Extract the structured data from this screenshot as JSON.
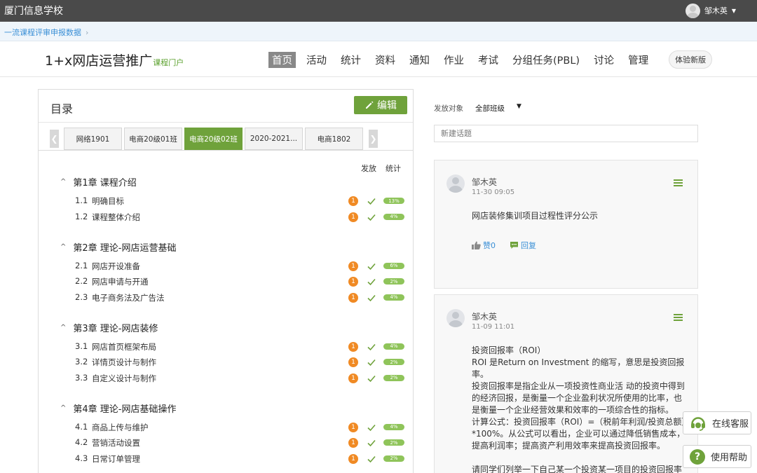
{
  "topbar": {
    "school": "厦门信息学校",
    "user_name": "邹木英"
  },
  "breadcrumb": {
    "item": "一流课程评审申报数据"
  },
  "course": {
    "title": "1+x网店运营推广",
    "subtitle": "课程门户"
  },
  "nav": {
    "items": [
      "首页",
      "活动",
      "统计",
      "资料",
      "通知",
      "作业",
      "考试",
      "分组任务(PBL)",
      "讨论",
      "管理"
    ],
    "active": "首页",
    "new_version": "体验新版"
  },
  "catalog": {
    "title": "目录",
    "edit_label": "编辑",
    "tabs": [
      "网络1901",
      "电商20级01班",
      "电商20级02班",
      "2020-2021...",
      "电商1802"
    ],
    "active_tab": "电商20级02班",
    "col_publish": "发放",
    "col_stats": "统计",
    "chapters": [
      {
        "title": "第1章 课程介绍",
        "lessons": [
          {
            "num": "1.1",
            "name": "明确目标",
            "badge": "1",
            "progress": "13%"
          },
          {
            "num": "1.2",
            "name": "课程整体介绍",
            "badge": "1",
            "progress": "4%"
          }
        ]
      },
      {
        "title": "第2章 理论-网店运营基础",
        "lessons": [
          {
            "num": "2.1",
            "name": "网店开设准备",
            "badge": "1",
            "progress": "6%"
          },
          {
            "num": "2.2",
            "name": "网店申请与开通",
            "badge": "1",
            "progress": "2%"
          },
          {
            "num": "2.3",
            "name": "电子商务法及广告法",
            "badge": "1",
            "progress": "4%"
          }
        ]
      },
      {
        "title": "第3章 理论-网店装修",
        "lessons": [
          {
            "num": "3.1",
            "name": "网店首页框架布局",
            "badge": "1",
            "progress": "4%"
          },
          {
            "num": "3.2",
            "name": "详情页设计与制作",
            "badge": "1",
            "progress": "2%"
          },
          {
            "num": "3.3",
            "name": "自定义设计与制作",
            "badge": "1",
            "progress": "2%"
          }
        ]
      },
      {
        "title": "第4章 理论-网店基础操作",
        "lessons": [
          {
            "num": "4.1",
            "name": "商品上传与维护",
            "badge": "1",
            "progress": "4%"
          },
          {
            "num": "4.2",
            "name": "营销活动设置",
            "badge": "1",
            "progress": "2%"
          },
          {
            "num": "4.3",
            "name": "日常订单管理",
            "badge": "1",
            "progress": "2%"
          }
        ]
      }
    ]
  },
  "discussion": {
    "target_label": "发放对象",
    "target_value": "全部班级",
    "new_topic_placeholder": "新建话题",
    "posts": [
      {
        "author": "邹木英",
        "time": "11-30 09:05",
        "text": "网店装修集训项目过程性评分公示",
        "like_label": "赞0",
        "reply_label": "回复"
      },
      {
        "author": "邹木英",
        "time": "11-09 11:01",
        "text": "投资回报率（ROI）\nROI 是Return on Investment 的缩写，意思是投资回报率。\n投资回报率是指企业从一项投资性商业活 动的投资中得到的经济回报，是衡量一个企业盈利状况所使用的比率，也是衡量一个企业经营效果和效率的一项综合性的指标。\n计算公式：投资回报率（ROI）=（税前年利润/投资总额）*100%。从公式可以看出，企业可以通过降低销售成本，提高利润率；提高资产利用效率来提高投资回报率。\n\n请同学们列举一下自己某一个投资某一项目的投资回报率的"
      }
    ]
  },
  "floating": {
    "service_label": "在线客服",
    "help_label": "使用帮助"
  },
  "colors": {
    "accent_green": "#6fa23b",
    "badge_orange": "#f08a24",
    "progress_green": "#8fc45a",
    "link_blue": "#3a8fd6",
    "topbar": "#4a4a4a"
  }
}
